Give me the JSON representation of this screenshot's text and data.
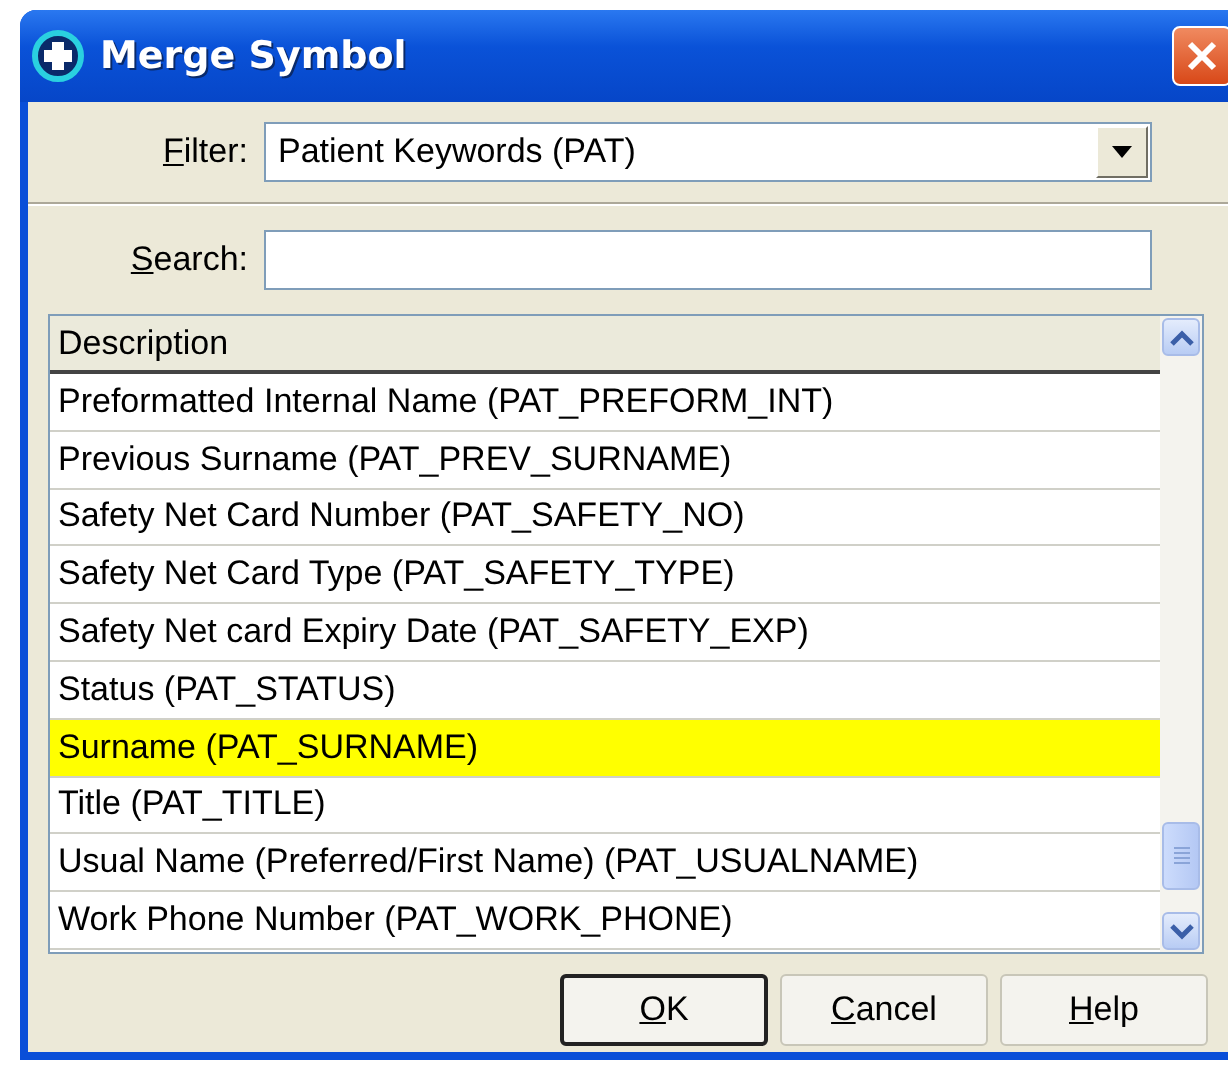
{
  "window": {
    "title": "Merge Symbol"
  },
  "filter": {
    "label": "Filter:",
    "mnemonic": true,
    "value": "Patient Keywords (PAT)"
  },
  "search": {
    "label": "Search:",
    "mnemonic": true
  },
  "table": {
    "columns": [
      "Description"
    ],
    "rows": [
      {
        "text": "Preformatted Internal Name (PAT_PREFORM_INT)",
        "selected": false
      },
      {
        "text": "Previous Surname (PAT_PREV_SURNAME)",
        "selected": false
      },
      {
        "text": "Safety Net Card Number (PAT_SAFETY_NO)",
        "selected": false
      },
      {
        "text": "Safety Net Card Type (PAT_SAFETY_TYPE)",
        "selected": false
      },
      {
        "text": "Safety Net card Expiry Date (PAT_SAFETY_EXP)",
        "selected": false
      },
      {
        "text": "Status (PAT_STATUS)",
        "selected": false
      },
      {
        "text": "Surname (PAT_SURNAME)",
        "selected": true
      },
      {
        "text": "Title (PAT_TITLE)",
        "selected": false
      },
      {
        "text": "Usual Name (Preferred/First Name) (PAT_USUALNAME)",
        "selected": false
      },
      {
        "text": "Work Phone Number (PAT_WORK_PHONE)",
        "selected": false
      }
    ]
  },
  "buttons": [
    {
      "label": "OK",
      "mnemonic": true,
      "default": true
    },
    {
      "label": "Cancel",
      "mnemonic": true,
      "default": false
    },
    {
      "label": "Help",
      "mnemonic": true,
      "default": false
    }
  ]
}
